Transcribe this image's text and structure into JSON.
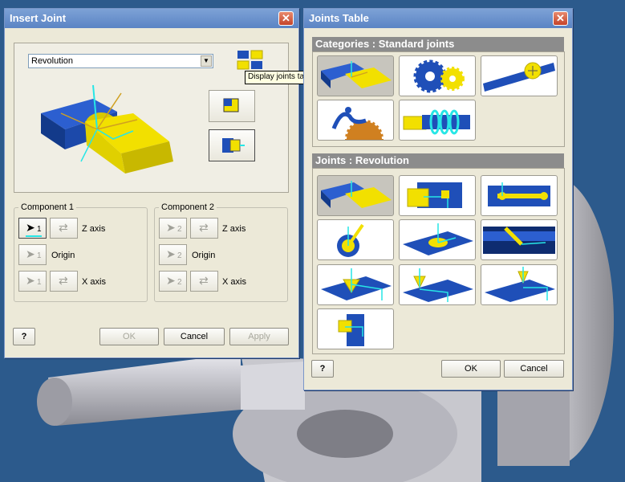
{
  "insert_joint": {
    "title": "Insert Joint",
    "joint_type_value": "Revolution",
    "tooltip": "Display joints table",
    "component1": {
      "title": "Component 1",
      "z_axis": "Z axis",
      "origin": "Origin",
      "x_axis": "X axis",
      "num": "1"
    },
    "component2": {
      "title": "Component 2",
      "z_axis": "Z axis",
      "origin": "Origin",
      "x_axis": "X axis",
      "num": "2"
    },
    "ok_label": "OK",
    "cancel_label": "Cancel",
    "apply_label": "Apply",
    "help_label": "?"
  },
  "joints_table": {
    "title": "Joints Table",
    "categories_header": "Categories : Standard joints",
    "joints_header": "Joints : Revolution",
    "ok_label": "OK",
    "cancel_label": "Cancel",
    "help_label": "?"
  },
  "colors": {
    "title_bar": "#5b84c4",
    "dialog_bg": "#ece9d8",
    "part_blue": "#1f4fb8",
    "part_yellow": "#f2e000",
    "axis_cyan": "#27e6e6"
  }
}
